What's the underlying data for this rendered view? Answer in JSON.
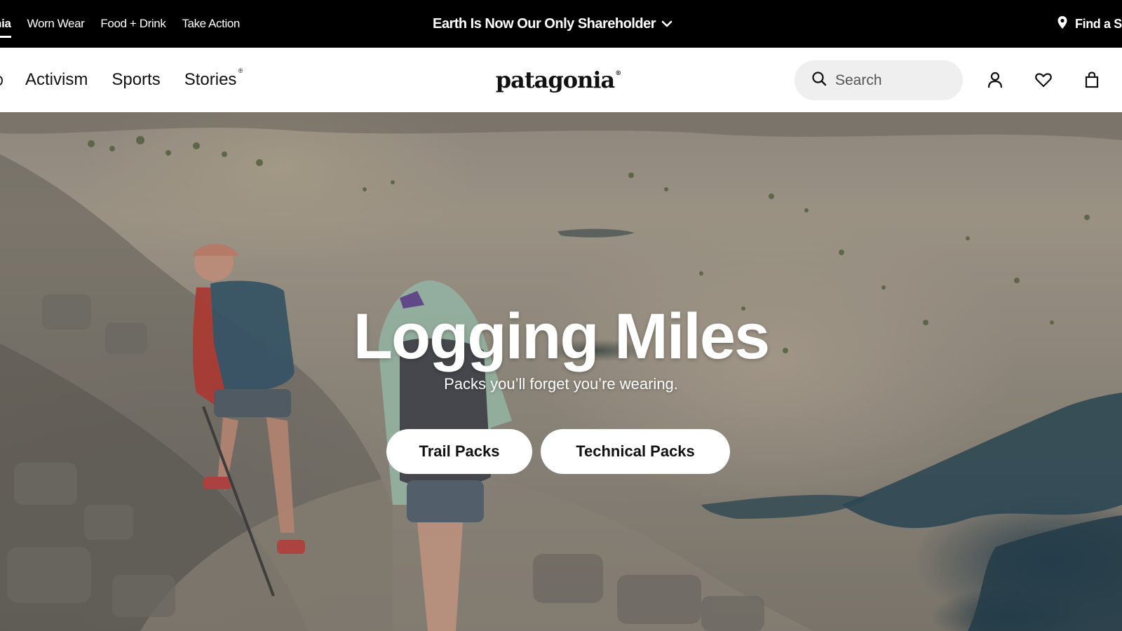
{
  "topbar": {
    "brand_tabs": [
      {
        "label": "nia"
      },
      {
        "label": "Worn Wear"
      },
      {
        "label": "Food + Drink"
      },
      {
        "label": "Take Action"
      }
    ],
    "announcement": "Earth Is Now Our Only Shareholder",
    "find_store": "Find a S"
  },
  "nav": {
    "links": [
      {
        "label": "Activism"
      },
      {
        "label": "Sports"
      },
      {
        "label": "Stories",
        "mark": "®"
      }
    ],
    "logo": "patagonia",
    "logo_mark": "®",
    "search_placeholder": "Search",
    "icons": [
      "user-icon",
      "heart-icon",
      "bag-icon"
    ]
  },
  "hero": {
    "title": "Logging Miles",
    "subtitle": "Packs you’ll forget you’re wearing.",
    "buttons": [
      {
        "label": "Trail Packs"
      },
      {
        "label": "Technical Packs"
      }
    ]
  },
  "colors": {
    "topbar_bg": "#000000",
    "nav_bg": "#ffffff",
    "search_bg": "#efefef",
    "button_bg": "#ffffff"
  }
}
